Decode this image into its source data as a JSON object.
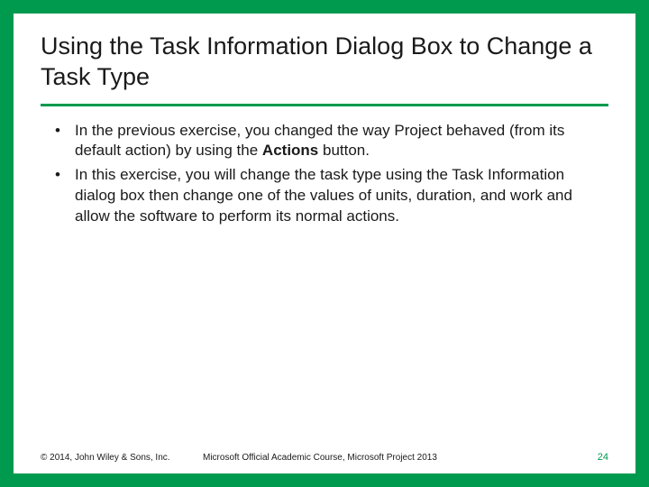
{
  "title": "Using the Task Information Dialog Box to Change a Task Type",
  "bullets": [
    {
      "pre": "In the previous exercise, you changed the way Project behaved (from its default action) by using the ",
      "bold": "Actions",
      "post": " button."
    },
    {
      "pre": "In this exercise, you will change the task type using the Task Information dialog box then change one of the values of units, duration, and work and allow the software to perform its normal actions.",
      "bold": "",
      "post": ""
    }
  ],
  "footer": {
    "copyright": "© 2014, John Wiley & Sons, Inc.",
    "course": "Microsoft Official Academic Course, Microsoft Project 2013",
    "page": "24"
  }
}
